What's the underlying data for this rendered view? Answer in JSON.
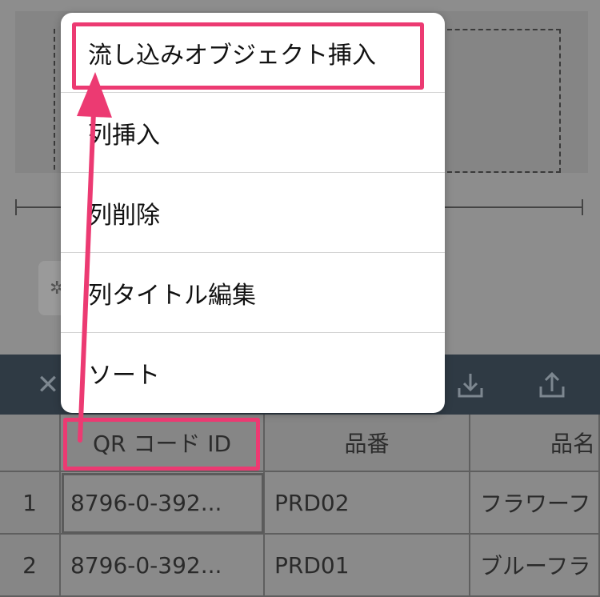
{
  "menu": {
    "items": [
      {
        "label": "流し込みオブジェクト挿入"
      },
      {
        "label": "列挿入"
      },
      {
        "label": "列削除"
      },
      {
        "label": "列タイトル編集"
      },
      {
        "label": "ソート"
      }
    ]
  },
  "table": {
    "columns": [
      "QR コード ID",
      "品番",
      "品名"
    ],
    "rows": [
      {
        "index": "1",
        "qr": "8796-0-392...",
        "part_no": "PRD02",
        "name": "フラワーフ"
      },
      {
        "index": "2",
        "qr": "8796-0-392...",
        "part_no": "PRD01",
        "name": "ブルーフラ"
      }
    ]
  },
  "toolbar": {
    "icons": [
      "close-icon",
      "download-icon",
      "share-icon"
    ]
  },
  "annotation": {
    "highlight_color": "#ec3a72"
  }
}
